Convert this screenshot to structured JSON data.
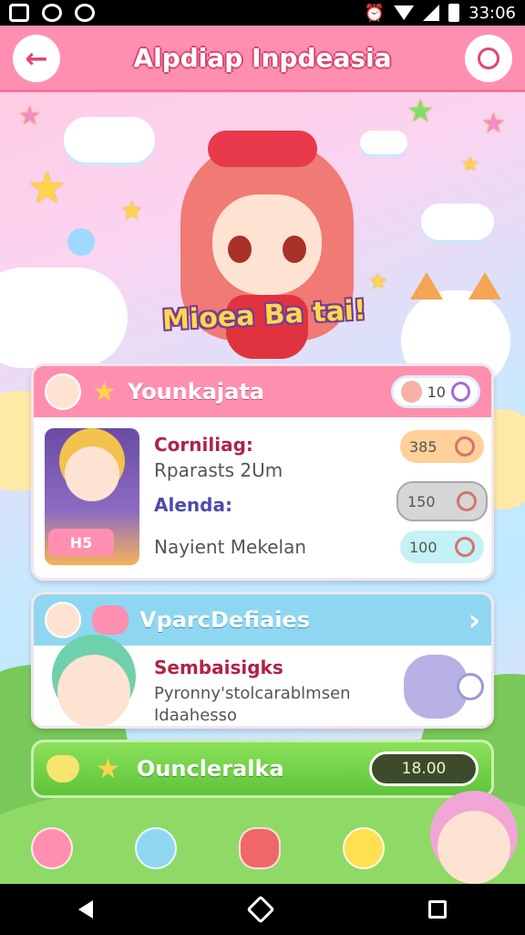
{
  "status_bar": {
    "time": "33:06"
  },
  "header": {
    "title": "Alpdiap Inpdeasia",
    "back_icon": "arrow-left-icon",
    "chat_icon": "chat-bubble-icon"
  },
  "hero": {
    "banner": "Mioea Ba tai!"
  },
  "card1": {
    "title": "Younkajata",
    "badge_value": "10",
    "portrait_tag": "H5",
    "rows": {
      "line1": "Corniliag:",
      "line2": "Rparasts 2Um",
      "line3": "Alenda:",
      "line4": "Nayient Mekelan"
    },
    "stats": [
      "385",
      "150",
      "100"
    ]
  },
  "card2": {
    "title": "VparcDefiaies",
    "line1": "Sembaisigks",
    "line2": "Pyronny'stolcarablmsen",
    "line3": "Idaahesso"
  },
  "reward_bar": {
    "title": "Ouncleralka",
    "value": "18.00"
  },
  "colors": {
    "header": "#ff8fb1",
    "card2_head": "#8fd7f1",
    "reward": "#6fd142"
  }
}
